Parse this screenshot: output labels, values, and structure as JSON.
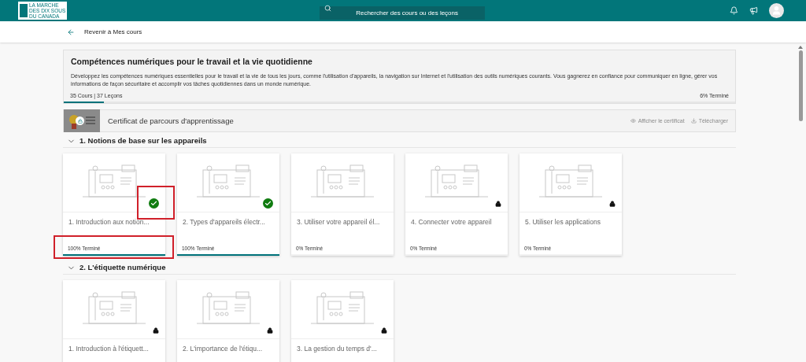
{
  "header": {
    "logo_lines": [
      "LA MARCHE",
      "DES DIX SOUS",
      "DU CANADA"
    ],
    "search": {
      "placeholder": "Rechercher des cours ou des leçons"
    }
  },
  "back_link": "Revenir à Mes cours",
  "path": {
    "title": "Compétences numériques pour le travail et la vie quotidienne",
    "description": "Développez les compétences numériques essentielles pour le travail et la vie de tous les jours, comme l'utilisation d'appareils, la navigation sur Internet et l'utilisation des outils numériques courants. Vous gagnerez en confiance pour communiquer en ligne, gérer vos informations de façon sécuritaire et accomplir vos tâches quotidiennes dans un monde numérique.",
    "counts": "35 Cours | 37 Leçons",
    "progress_label": "6% Terminé",
    "level": 0.06
  },
  "certificate": {
    "title": "Certificat de parcours d'apprentissage",
    "locked": true,
    "actions": [
      {
        "kind": "view",
        "label": "Afficher le certificat",
        "disabled": true
      },
      {
        "kind": "download",
        "label": "Télécharger",
        "disabled": true
      }
    ]
  },
  "sections": [
    {
      "title": "1. Notions de base sur les appareils",
      "expanded": true,
      "courses": [
        {
          "title": "1. Introduction aux notion...",
          "completed": true,
          "locked": false,
          "progress_label": "100% Terminé",
          "level": 1,
          "highlight_badge": true,
          "highlight_progress": true
        },
        {
          "title": "2. Types d'appareils électr...",
          "completed": true,
          "locked": false,
          "progress_label": "100% Terminé",
          "level": 1,
          "highlight_badge": false,
          "highlight_progress": false
        },
        {
          "title": "3. Utiliser votre appareil él...",
          "completed": false,
          "locked": false,
          "progress_label": "0% Terminé",
          "level": 0,
          "highlight_badge": false,
          "highlight_progress": false
        },
        {
          "title": "4. Connecter votre appareil",
          "completed": false,
          "locked": true,
          "progress_label": "0% Terminé",
          "level": 0,
          "highlight_badge": false,
          "highlight_progress": false
        },
        {
          "title": "5. Utiliser les applications",
          "completed": false,
          "locked": true,
          "progress_label": "0% Terminé",
          "level": 0,
          "highlight_badge": false,
          "highlight_progress": false
        }
      ]
    },
    {
      "title": "2. L'étiquette numérique",
      "expanded": true,
      "courses": [
        {
          "title": "1. Introduction à l'étiquett...",
          "completed": false,
          "locked": true,
          "highlight_badge": false,
          "highlight_progress": false
        },
        {
          "title": "2. L'importance de l'étiqu...",
          "completed": false,
          "locked": true,
          "highlight_badge": false,
          "highlight_progress": false
        },
        {
          "title": "3. La gestion du temps d'...",
          "completed": false,
          "locked": true,
          "highlight_badge": false,
          "highlight_progress": false
        }
      ]
    }
  ]
}
